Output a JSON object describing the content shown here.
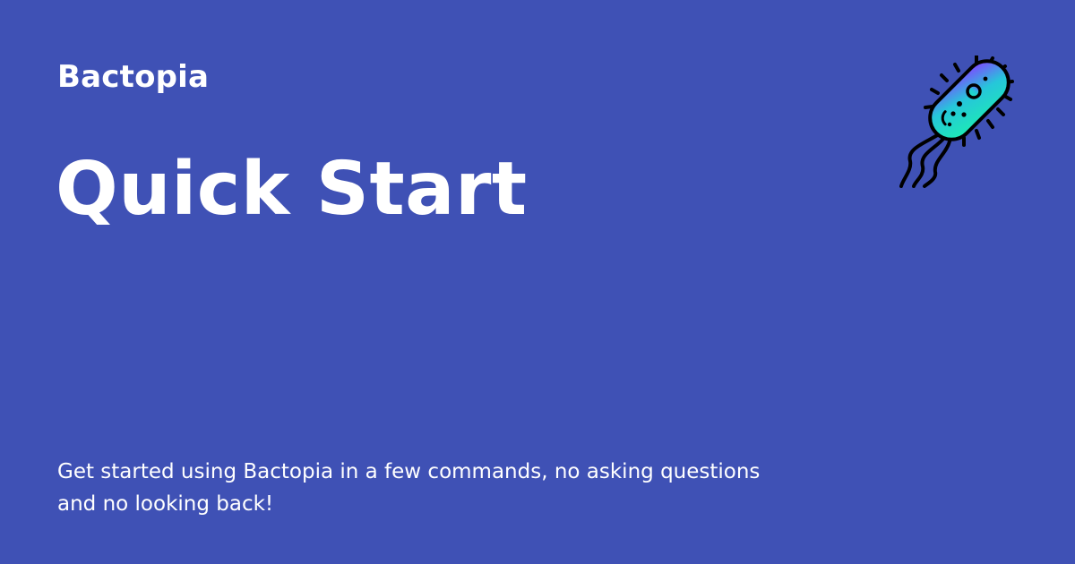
{
  "site": {
    "name": "Bactopia"
  },
  "page": {
    "title": "Quick Start",
    "description": "Get started using Bactopia in a few commands, no asking questions and no looking back!"
  },
  "logo": {
    "icon": "bacterium-icon",
    "gradient_start": "#7c4dff",
    "gradient_end": "#1de9b6"
  },
  "theme": {
    "background": "#3f51b5",
    "text": "#ffffff"
  }
}
